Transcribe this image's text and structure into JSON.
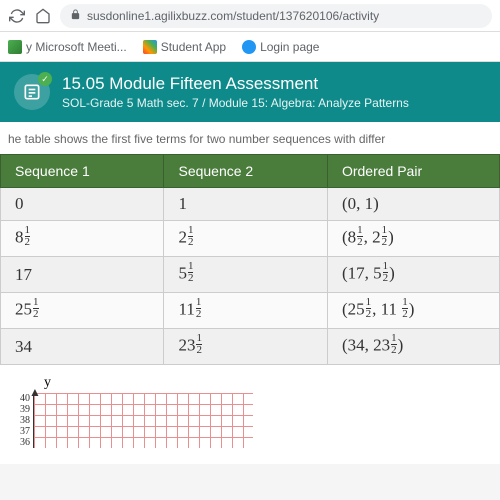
{
  "browser": {
    "url": "susdonline1.agilixbuzz.com/student/137620106/activity"
  },
  "bookmarks": {
    "item1": "y Microsoft Meeti...",
    "item2": "Student App",
    "item3": "Login page"
  },
  "header": {
    "title": "15.05 Module Fifteen Assessment",
    "subtitle": "SOL-Grade 5 Math sec. 7 / Module 15: Algebra: Analyze Patterns"
  },
  "prompt": "he table shows the first five terms for two number sequences with differ",
  "table": {
    "h1": "Sequence 1",
    "h2": "Sequence 2",
    "h3": "Ordered Pair",
    "r1c1": "0",
    "r1c2": "1",
    "r1c3": "(0, 1)",
    "r2c1_int": "8",
    "r2c2_int": "2",
    "r2c3_a": "8",
    "r2c3_b": "2",
    "r3c1": "17",
    "r3c2_int": "5",
    "r3c3_a": "17",
    "r3c3_b": "5",
    "r4c1_int": "25",
    "r4c2_int": "11",
    "r4c3_a": "25",
    "r4c3_b": "11",
    "r5c1": "34",
    "r5c2_int": "23",
    "r5c3_a": "34",
    "r5c3_b": "23"
  },
  "chart_data": {
    "type": "scatter",
    "title": "",
    "xlabel": "",
    "ylabel": "y",
    "ylim": [
      36,
      40
    ],
    "y_ticks": [
      "40",
      "39",
      "38",
      "37",
      "36"
    ],
    "series": []
  },
  "graph": {
    "y_label": "y",
    "t1": "40",
    "t2": "39",
    "t3": "38",
    "t4": "37",
    "t5": "36"
  }
}
